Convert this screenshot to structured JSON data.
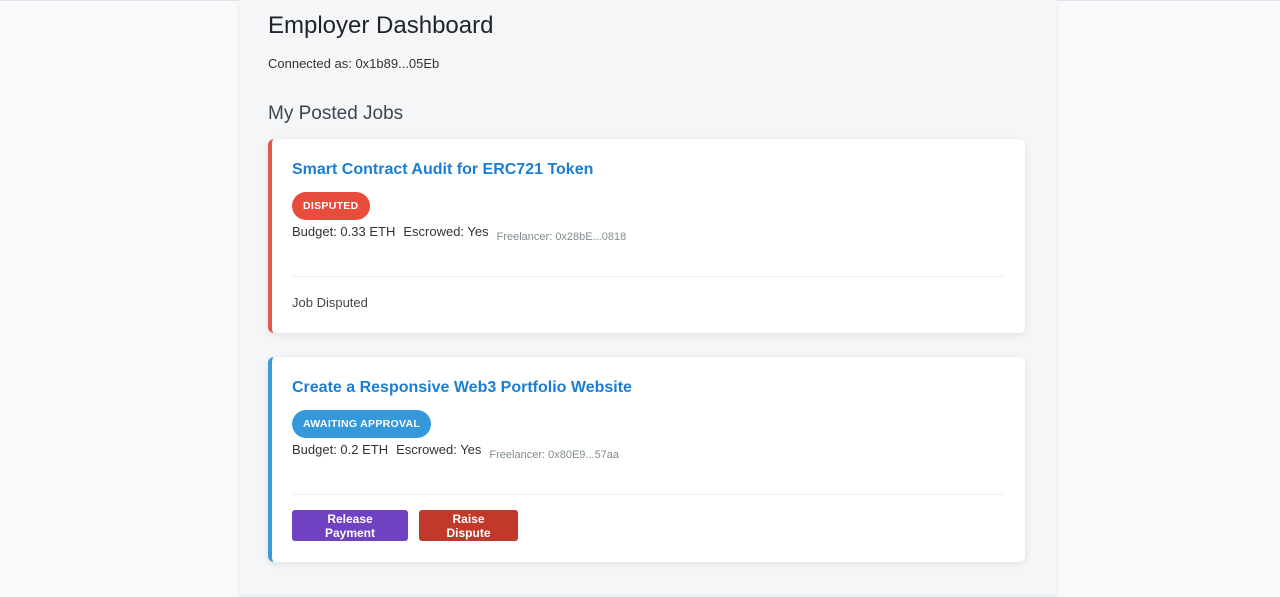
{
  "header": {
    "title": "Employer Dashboard",
    "connected_label": "Connected as: 0x1b89...05Eb"
  },
  "section": {
    "title": "My Posted Jobs"
  },
  "jobs": [
    {
      "title": "Smart Contract Audit for ERC721 Token",
      "status": "DISPUTED",
      "status_color": "#e74c3c",
      "budget": "Budget: 0.33 ETH",
      "escrowed": "Escrowed: Yes",
      "freelancer": "Freelancer: 0x28bE...0818",
      "footer_text": "Job Disputed"
    },
    {
      "title": "Create a Responsive Web3 Portfolio Website",
      "status": "AWAITING APPROVAL",
      "status_color": "#3498db",
      "budget": "Budget: 0.2 ETH",
      "escrowed": "Escrowed: Yes",
      "freelancer": "Freelancer: 0x80E9...57aa",
      "actions": {
        "release_label": "Release Payment",
        "dispute_label": "Raise Dispute"
      }
    }
  ],
  "colors": {
    "disputed_accent": "#e05a4b",
    "awaiting_accent": "#3a9bd5",
    "link": "#1a7fd4",
    "release_button": "#6f42c1",
    "dispute_button": "#c0392b"
  }
}
